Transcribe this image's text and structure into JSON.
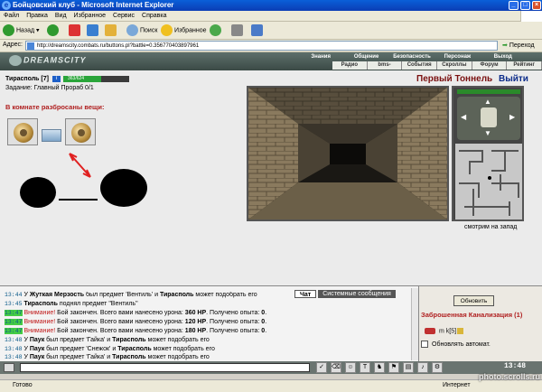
{
  "window": {
    "title": "Бойцовский клуб - Microsoft Internet Explorer"
  },
  "menu": [
    "Файл",
    "Правка",
    "Вид",
    "Избранное",
    "Сервис",
    "Справка"
  ],
  "toolbar": {
    "back": "Назад",
    "search": "Поиск",
    "favorites": "Избранное"
  },
  "address": {
    "label": "Адрес:",
    "url": "http://dreamscity.combats.ru/buttons.pl?battle=0.356770403897961",
    "go": "Переход"
  },
  "site": {
    "logo": "DREAMSCITY",
    "topnav": [
      "Знания",
      "Общение",
      "Безопасность",
      "Персонаж",
      "Выход"
    ],
    "subnav": [
      "Радио",
      "bms-история",
      "События",
      "Скроллы",
      "Форум",
      "Рейтинг"
    ]
  },
  "character": {
    "name": "Тирасполь [7]",
    "hp_text": "363/624",
    "hp_fraction": 0.58,
    "task": "Задание: Главный Прораб 0/1"
  },
  "room": {
    "items_header": "В комнате разбросаны вещи:"
  },
  "location": {
    "name": "Первый Тоннель",
    "exit": "Выйти",
    "look": "смотрим на запад"
  },
  "chat": {
    "tabs": [
      "Чат",
      "Системные сообщения"
    ],
    "lines": [
      {
        "ts": "13:44",
        "segments": [
          "У ",
          "Жуткая Мерзость",
          " был предмет 'Вентиль' и ",
          "Тирасполь",
          " может подобрать его"
        ]
      },
      {
        "ts": "13:45",
        "segments": [
          "",
          "Тирасполь",
          " поднял предмет \"Вентиль\""
        ]
      },
      {
        "ts": "13:47",
        "warn": "Внимание!",
        "text": " Бой закончен. Всего вами нанесено урона: ",
        "dmg": "360 HP",
        "text2": ". Получено опыта: ",
        "exp": "0",
        "end": "."
      },
      {
        "ts": "13:47",
        "warn": "Внимание!",
        "text": " Бой закончен. Всего вами нанесено урона: ",
        "dmg": "120 HP",
        "text2": ". Получено опыта: ",
        "exp": "0",
        "end": "."
      },
      {
        "ts": "13:47",
        "warn": "Внимание!",
        "text": " Бой закончен. Всего вами нанесено урона: ",
        "dmg": "180 HP",
        "text2": ". Получено опыта: ",
        "exp": "0",
        "end": "."
      },
      {
        "ts": "13:48",
        "segments": [
          "У ",
          "Паук",
          " был предмет 'Гайка' и ",
          "Тирасполь",
          " может подобрать его"
        ]
      },
      {
        "ts": "13:48",
        "segments": [
          "У ",
          "Паук",
          " был предмет 'Снежок' и ",
          "Тирасполь",
          " может подобрать его"
        ]
      },
      {
        "ts": "13:48",
        "segments": [
          "У ",
          "Паук",
          " был предмет 'Гайка' и ",
          "Тирасполь",
          " может подобрать его"
        ]
      }
    ]
  },
  "side": {
    "refresh": "Обновить",
    "title": "Заброшенная Канализация (1)",
    "user": "m k[5]",
    "auto": "Обновлять автомат."
  },
  "clock": "13:48",
  "status": {
    "ready": "Готово",
    "zone": "Интернет"
  },
  "watermark": "photo.scrolls.ru"
}
